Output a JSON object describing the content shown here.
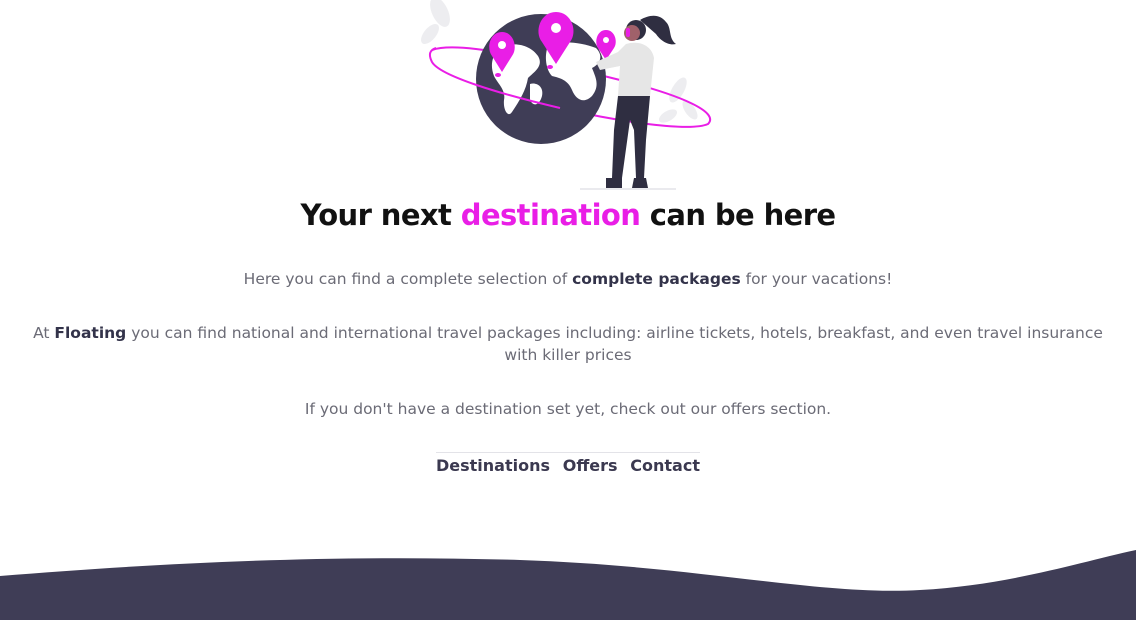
{
  "colors": {
    "accent": "#e91ee6",
    "dark": "#3f3d56",
    "text": "#6b6b76"
  },
  "hero": {
    "title_start": "Your next ",
    "title_accent": "destination",
    "title_end": " can be here",
    "illustration": "woman-globe-map-pins-illustration"
  },
  "intro": {
    "p1_start": "Here you can find a complete selection of ",
    "p1_bold": "complete packages",
    "p1_end": " for your vacations!",
    "p2_start": "At ",
    "p2_bold": "Floating",
    "p2_end": " you can find national and international travel packages including: airline tickets, hotels, breakfast, and even travel insurance with killer prices",
    "p3": "If you don't have a destination set yet, check out our offers section."
  },
  "nav": {
    "links": [
      "Destinations",
      "Offers",
      "Contact"
    ]
  }
}
